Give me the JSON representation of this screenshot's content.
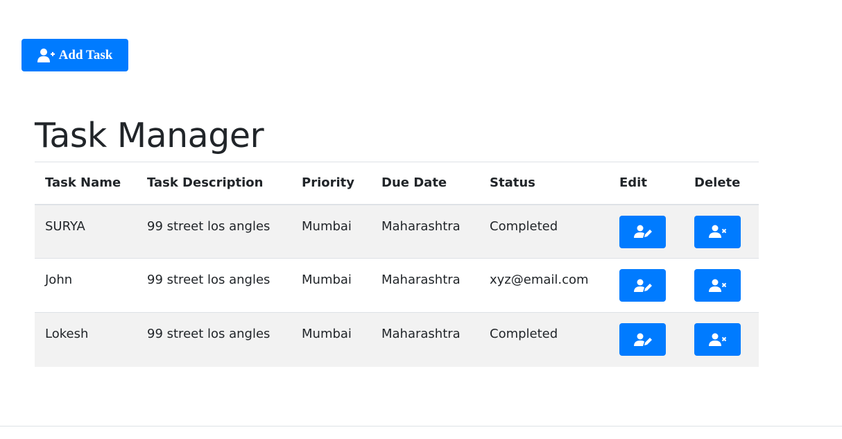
{
  "toolbar": {
    "add_label": "Add Task",
    "add_icon": "user-plus-icon"
  },
  "page": {
    "title": "Task Manager"
  },
  "table": {
    "headers": [
      "Task Name",
      "Task Description",
      "Priority",
      "Due Date",
      "Status",
      "Edit",
      "Delete"
    ],
    "rows": [
      {
        "name": "SURYA",
        "description": "99 street los angles",
        "priority": "Mumbai",
        "due_date": "Maharashtra",
        "status": "Completed"
      },
      {
        "name": "John",
        "description": "99 street los angles",
        "priority": "Mumbai",
        "due_date": "Maharashtra",
        "status": "xyz@email.com"
      },
      {
        "name": "Lokesh",
        "description": "99 street los angles",
        "priority": "Mumbai",
        "due_date": "Maharashtra",
        "status": "Completed"
      }
    ],
    "edit_icon": "user-edit-icon",
    "delete_icon": "user-times-icon"
  },
  "colors": {
    "primary": "#007bff",
    "stripe": "#f2f2f2",
    "border": "#dee2e6",
    "text": "#212529"
  }
}
